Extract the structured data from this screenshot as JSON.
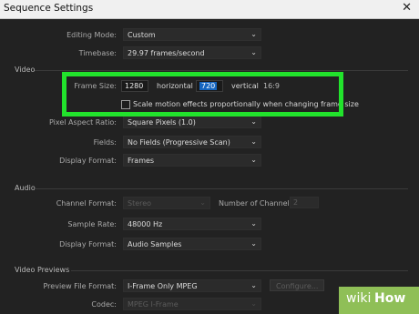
{
  "window": {
    "title": "Sequence Settings"
  },
  "general": {
    "editing_mode_label": "Editing Mode:",
    "editing_mode_value": "Custom",
    "timebase_label": "Timebase:",
    "timebase_value": "29.97  frames/second"
  },
  "video": {
    "section_label": "Video",
    "frame_size_label": "Frame Size:",
    "horizontal_value": "1280",
    "horizontal_label": "horizontal",
    "vertical_value": "720",
    "vertical_label": "vertical",
    "aspect": "16:9",
    "scale_checkbox_label": "Scale motion effects proportionally when changing frame size",
    "pixel_aspect_label": "Pixel Aspect Ratio:",
    "pixel_aspect_value": "Square Pixels (1.0)",
    "fields_label": "Fields:",
    "fields_value": "No Fields (Progressive Scan)",
    "display_format_label": "Display Format:",
    "display_format_value": "Frames"
  },
  "audio": {
    "section_label": "Audio",
    "channel_format_label": "Channel Format:",
    "channel_format_value": "Stereo",
    "num_channels_label": "Number of Channels:",
    "num_channels_value": "2",
    "sample_rate_label": "Sample Rate:",
    "sample_rate_value": "48000 Hz",
    "display_format_label": "Display Format:",
    "display_format_value": "Audio Samples"
  },
  "previews": {
    "section_label": "Video Previews",
    "preview_file_format_label": "Preview File Format:",
    "preview_file_format_value": "I-Frame Only MPEG",
    "configure_label": "Configure...",
    "codec_label": "Codec:",
    "codec_value": "MPEG I-Frame"
  },
  "watermark": {
    "wiki": "wiki",
    "how": "How"
  }
}
